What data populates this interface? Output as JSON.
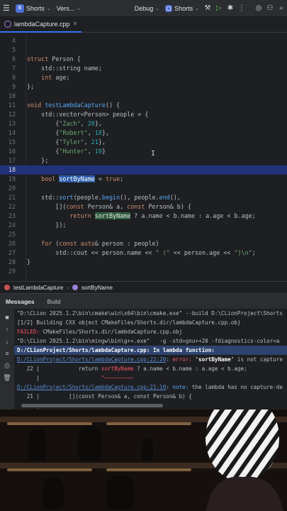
{
  "toolbar": {
    "project_badge": "S",
    "project_name": "Shorts",
    "vcs_label": "Vers...",
    "build_config": "Debug",
    "run_config": "Shorts"
  },
  "tab": {
    "filename": "lambdaCapture.cpp"
  },
  "editor": {
    "highlighted_line": 18,
    "lines": [
      {
        "n": "4",
        "html": ""
      },
      {
        "n": "5",
        "html": ""
      },
      {
        "n": "6",
        "html": "<span class=\"kw\">struct</span> Person {"
      },
      {
        "n": "7",
        "html": "    std::string name;"
      },
      {
        "n": "8",
        "html": "    <span class=\"kw\">int</span> age;"
      },
      {
        "n": "9",
        "html": "};"
      },
      {
        "n": "10",
        "html": ""
      },
      {
        "n": "11",
        "html": "<span class=\"kw\">void</span> <span class=\"fn\">testLambdaCapture</span>() {"
      },
      {
        "n": "12",
        "html": "    std::vector&lt;Person&gt; people = {"
      },
      {
        "n": "13",
        "html": "        {<span class=\"str\">\"Zach\"</span>, <span class=\"num\">20</span>},"
      },
      {
        "n": "14",
        "html": "        {<span class=\"str\">\"Robert\"</span>, <span class=\"num\">18</span>},"
      },
      {
        "n": "15",
        "html": "        {<span class=\"str\">\"Tyler\"</span>, <span class=\"num\">21</span>},"
      },
      {
        "n": "16",
        "html": "        {<span class=\"str\">\"Hunter\"</span>, <span class=\"num\">19</span>}"
      },
      {
        "n": "17",
        "html": "    };"
      },
      {
        "n": "18",
        "html": ""
      },
      {
        "n": "19",
        "html": "    <span class=\"kw\">bool</span> <span class=\"sel\">sortByName</span> = <span class=\"kw\">true</span>;"
      },
      {
        "n": "20",
        "html": ""
      },
      {
        "n": "21",
        "html": "    std::<span class=\"fn\">sort</span>(people.<span class=\"fn\">begin</span>(), people.<span class=\"fn\">end</span>(),"
      },
      {
        "n": "22",
        "html": "        [](<span class=\"kw\">const</span> Person&amp; a, <span class=\"kw\">const</span> Person&amp; b) {"
      },
      {
        "n": "23",
        "html": "            <span class=\"kw\">return</span> <span class=\"hlvar\">sortByName</span> ? a.name &lt; b.name : a.age &lt; b.age;"
      },
      {
        "n": "24",
        "html": "        });"
      },
      {
        "n": "25",
        "html": ""
      },
      {
        "n": "26",
        "html": "    <span class=\"kw\">for</span> (<span class=\"kw\">const auto</span>&amp; person : people)"
      },
      {
        "n": "27",
        "html": "        std::cout &lt;&lt; person.name &lt;&lt; <span class=\"str\">\" (\"</span> &lt;&lt; person.age &lt;&lt; <span class=\"str\">\")\\n\"</span>;"
      },
      {
        "n": "28",
        "html": "}"
      },
      {
        "n": "29",
        "html": ""
      }
    ]
  },
  "breadcrumb": {
    "function": "testLambdaCapture",
    "variable": "sortByName"
  },
  "panel": {
    "title": "Messages",
    "tab": "Build"
  },
  "console": {
    "lines": [
      {
        "html": "\"D:\\CLion 2025.1.2\\bin\\cmake\\win\\x64\\bin\\cmake.exe\" --build D:\\CLionProject\\Shorts"
      },
      {
        "html": "[1/2] Building CXX object CMakeFiles/Shorts.dir/lambdaCapture.cpp.obj"
      },
      {
        "html": "<span class=\"c-err\">FAILED:</span> CMakeFiles/Shorts.dir/lambdaCapture.cpp.obj"
      },
      {
        "html": "\"D:\\CLion 2025.1.2\\bin\\mingw\\bin\\g++.exe\"   -g -std=gnu++20 -fdiagnostics-color=a"
      },
      {
        "html": "<span class=\"c-bold\">D:/CLionProject/Shorts/lambdaCapture.cpp: In lambda function:</span>",
        "sel": true
      },
      {
        "html": "<span class=\"c-link\">D:/CLionProject/Shorts/lambdaCapture.cpp:22:20</span>: <span class=\"c-err\">error:</span> <span class=\"c-bold\">'sortByName'</span> is not capture"
      },
      {
        "html": "   22 |            return <span class=\"c-err\">sortByName</span> ? a.name &lt; b.name : a.age &lt; b.age;"
      },
      {
        "html": "      |                   <span class=\"c-err\">^~~~~~~~~~</span>"
      },
      {
        "html": "<span class=\"c-link\">D:/CLionProject/Shorts/lambdaCapture.cpp:21:10</span>: <span class=\"c-note\">note:</span> the lambda has no capture-de"
      },
      {
        "html": "   21 |         [](const Person&amp; a, const Person&amp; b) {"
      },
      {
        "html": "      |          <span class=\"c-note\">^</span>"
      }
    ]
  },
  "colors": {
    "accent": "#3574f0",
    "error": "#f75464",
    "keyword": "#cf8e6d",
    "string": "#6aab73",
    "number": "#2aacb8"
  }
}
